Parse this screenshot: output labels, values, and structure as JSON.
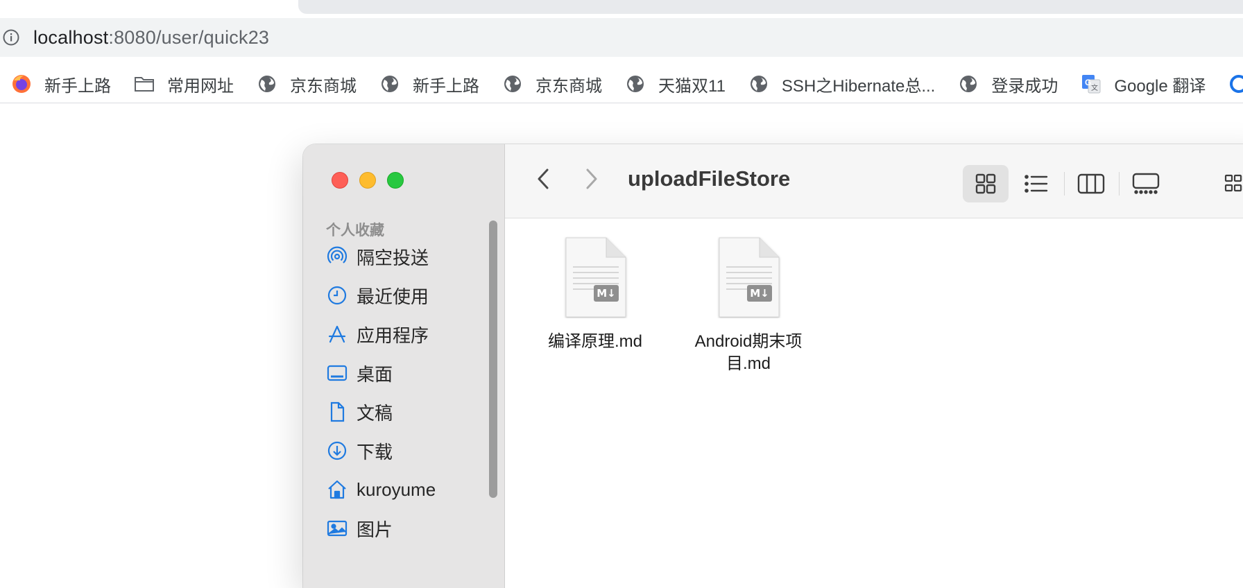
{
  "browser": {
    "url_host": "localhost",
    "url_rest": ":8080/user/quick23"
  },
  "bookmarks": [
    {
      "label": "新手上路",
      "icon": "firefox-icon"
    },
    {
      "label": "常用网址",
      "icon": "folder-icon"
    },
    {
      "label": "京东商城",
      "icon": "globe-icon"
    },
    {
      "label": "新手上路",
      "icon": "globe-icon"
    },
    {
      "label": "京东商城",
      "icon": "globe-icon"
    },
    {
      "label": "天猫双11",
      "icon": "globe-icon"
    },
    {
      "label": "SSH之Hibernate总...",
      "icon": "globe-icon"
    },
    {
      "label": "登录成功",
      "icon": "globe-icon"
    },
    {
      "label": "Google 翻译",
      "icon": "google-translate-icon"
    }
  ],
  "finder": {
    "title": "uploadFileStore",
    "sidebar_section": "个人收藏",
    "sidebar_items": [
      {
        "label": "隔空投送",
        "icon": "airdrop-icon"
      },
      {
        "label": "最近使用",
        "icon": "clock-icon"
      },
      {
        "label": "应用程序",
        "icon": "applications-icon"
      },
      {
        "label": "桌面",
        "icon": "desktop-icon"
      },
      {
        "label": "文稿",
        "icon": "document-icon"
      },
      {
        "label": "下载",
        "icon": "download-icon"
      },
      {
        "label": "kuroyume",
        "icon": "home-icon"
      },
      {
        "label": "图片",
        "icon": "pictures-icon"
      }
    ],
    "files": [
      {
        "name": "编译原理.md",
        "badge": "M↓"
      },
      {
        "name": "Android期末项目.md",
        "badge": "M↓"
      }
    ],
    "active_view": "icon"
  },
  "colors": {
    "accent": "#1f7ae0",
    "close": "#fe5f57",
    "minimize": "#febc2e",
    "zoom": "#28c840"
  }
}
